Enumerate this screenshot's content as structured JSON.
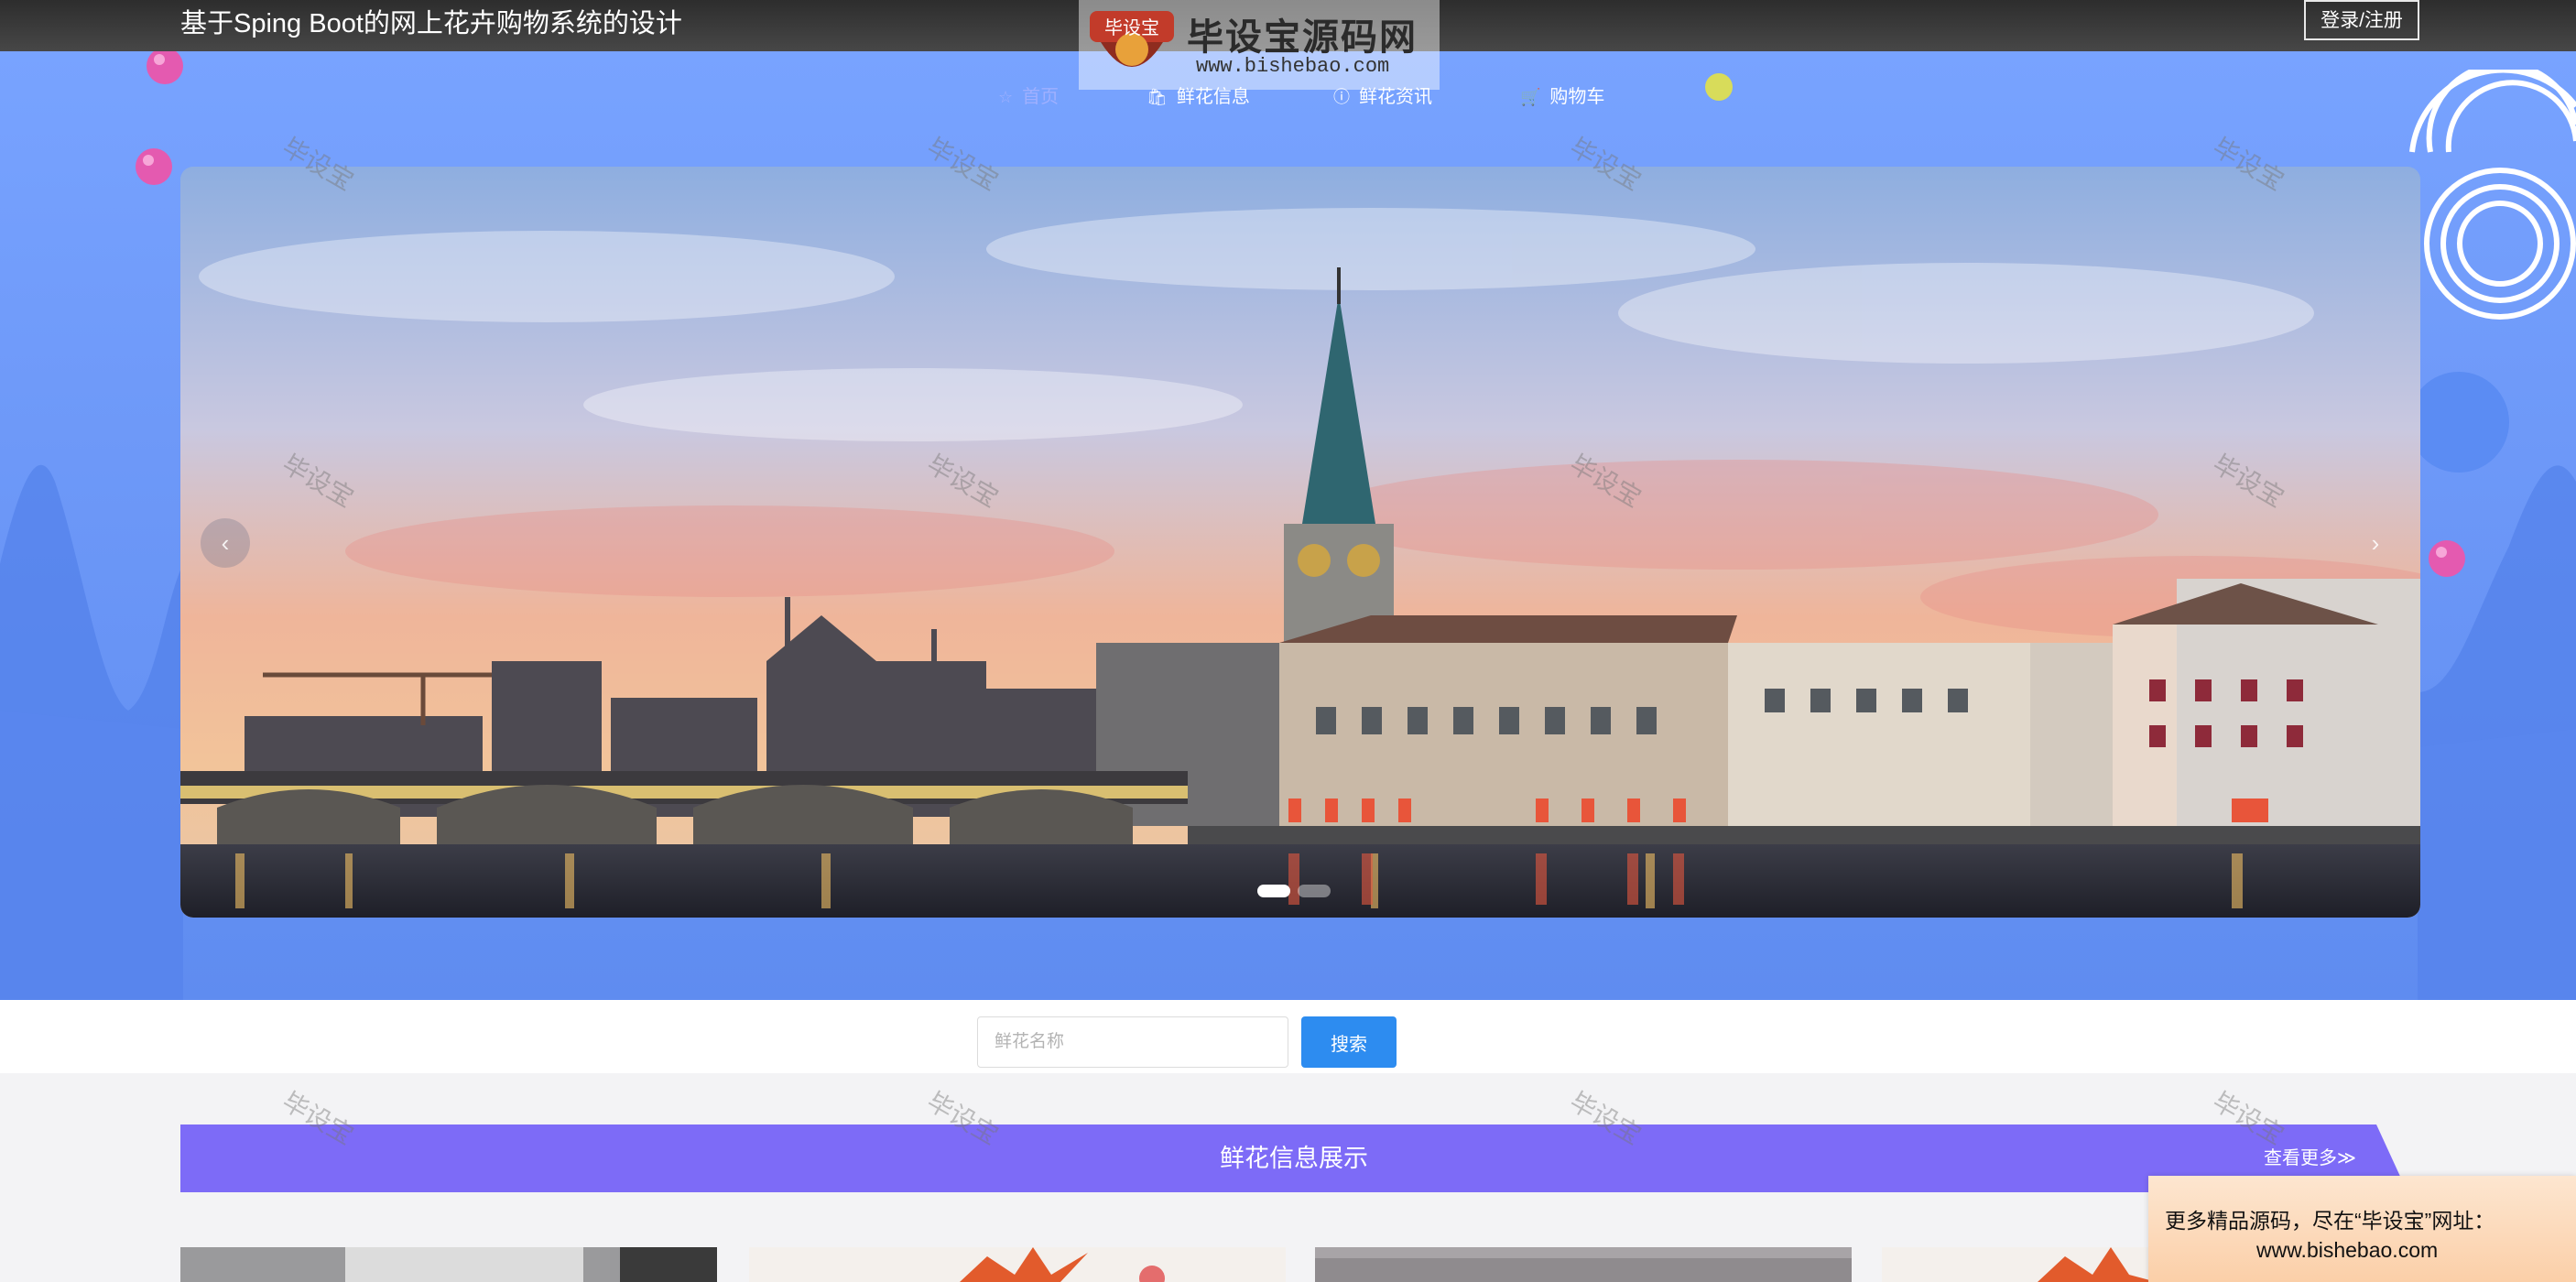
{
  "header": {
    "title": "基于Sping Boot的网上花卉购物系统的设计",
    "login_label": "登录/注册"
  },
  "nav": {
    "items": [
      {
        "label": "首页",
        "icon": "star-icon",
        "active": true
      },
      {
        "label": "鲜花信息",
        "icon": "bag-icon",
        "active": false
      },
      {
        "label": "鲜花资讯",
        "icon": "info-icon",
        "active": false
      },
      {
        "label": "购物车",
        "icon": "cart-icon",
        "active": false
      }
    ]
  },
  "carousel": {
    "prev_label": "‹",
    "next_label": "›",
    "slide_count": 2,
    "active_index": 0
  },
  "search": {
    "placeholder": "鲜花名称",
    "button_label": "搜索"
  },
  "section": {
    "title": "鲜花信息展示",
    "more_label": "查看更多≫"
  },
  "ad": {
    "line1": "更多精品源码，尽在“毕设宝”网址：",
    "line2": "www.bishebao.com"
  },
  "watermark": {
    "logo_badge": "毕设宝",
    "logo_text": "毕设宝源码网",
    "logo_url": "www.bishebao.com",
    "tile_text": "毕设宝"
  },
  "colors": {
    "hero": "#6f9af9",
    "banner": "#7d6bf7",
    "search_button": "#2d8cf0",
    "topbar": "#3a3a3a"
  }
}
